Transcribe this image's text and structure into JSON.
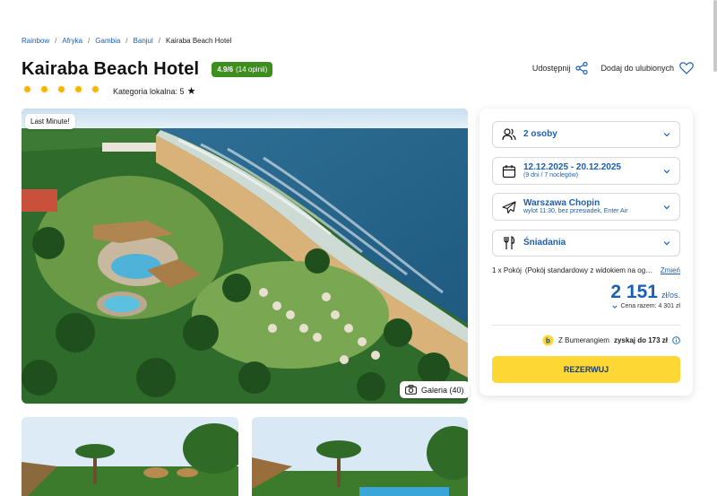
{
  "breadcrumb": [
    "Rainbow",
    "Afryka",
    "Gambia",
    "Banjul",
    "Kairaba Beach Hotel"
  ],
  "hotel": {
    "name": "Kairaba Beach Hotel",
    "rating_score": "4.9/6",
    "rating_count": "(14 opinii)",
    "suns": 5,
    "local_category_label": "Kategoria lokalna: 5",
    "local_category_icon": "star-icon"
  },
  "actions": {
    "share_label": "Udostępnij",
    "share_icon": "share-icon",
    "favorite_label": "Dodaj do ulubionych",
    "favorite_icon": "heart-icon"
  },
  "gallery": {
    "badge": "Last Minute!",
    "button_label": "Galeria (40)",
    "button_icon": "camera-icon"
  },
  "booking": {
    "persons": "2 osoby",
    "dates": "12.12.2025 - 20.12.2025",
    "dates_sub": "(9 dni / 7 noclegów)",
    "airport": "Warszawa Chopin",
    "flight_sub": "wylot 11:30, bez przesiadek, Enter Air",
    "board": "Śniadania",
    "room_count": "1 x Pokój",
    "room_desc": "(Pokój standardowy z widokiem na ogród)",
    "room_change": "Zmień",
    "price": "2 151",
    "price_unit": "zł/os.",
    "total_label": "Cena razem: 4 301 zł",
    "boomerang_prefix": "Z Bumerangiem",
    "boomerang_value": "zyskaj do 173 zł",
    "reserve_label": "REZERWUJ"
  },
  "colors": {
    "accent_blue": "#1a5fb4",
    "rating_green": "#3e8e1f",
    "reserve_yellow": "#fdd835",
    "sun_yellow": "#f7b500"
  }
}
